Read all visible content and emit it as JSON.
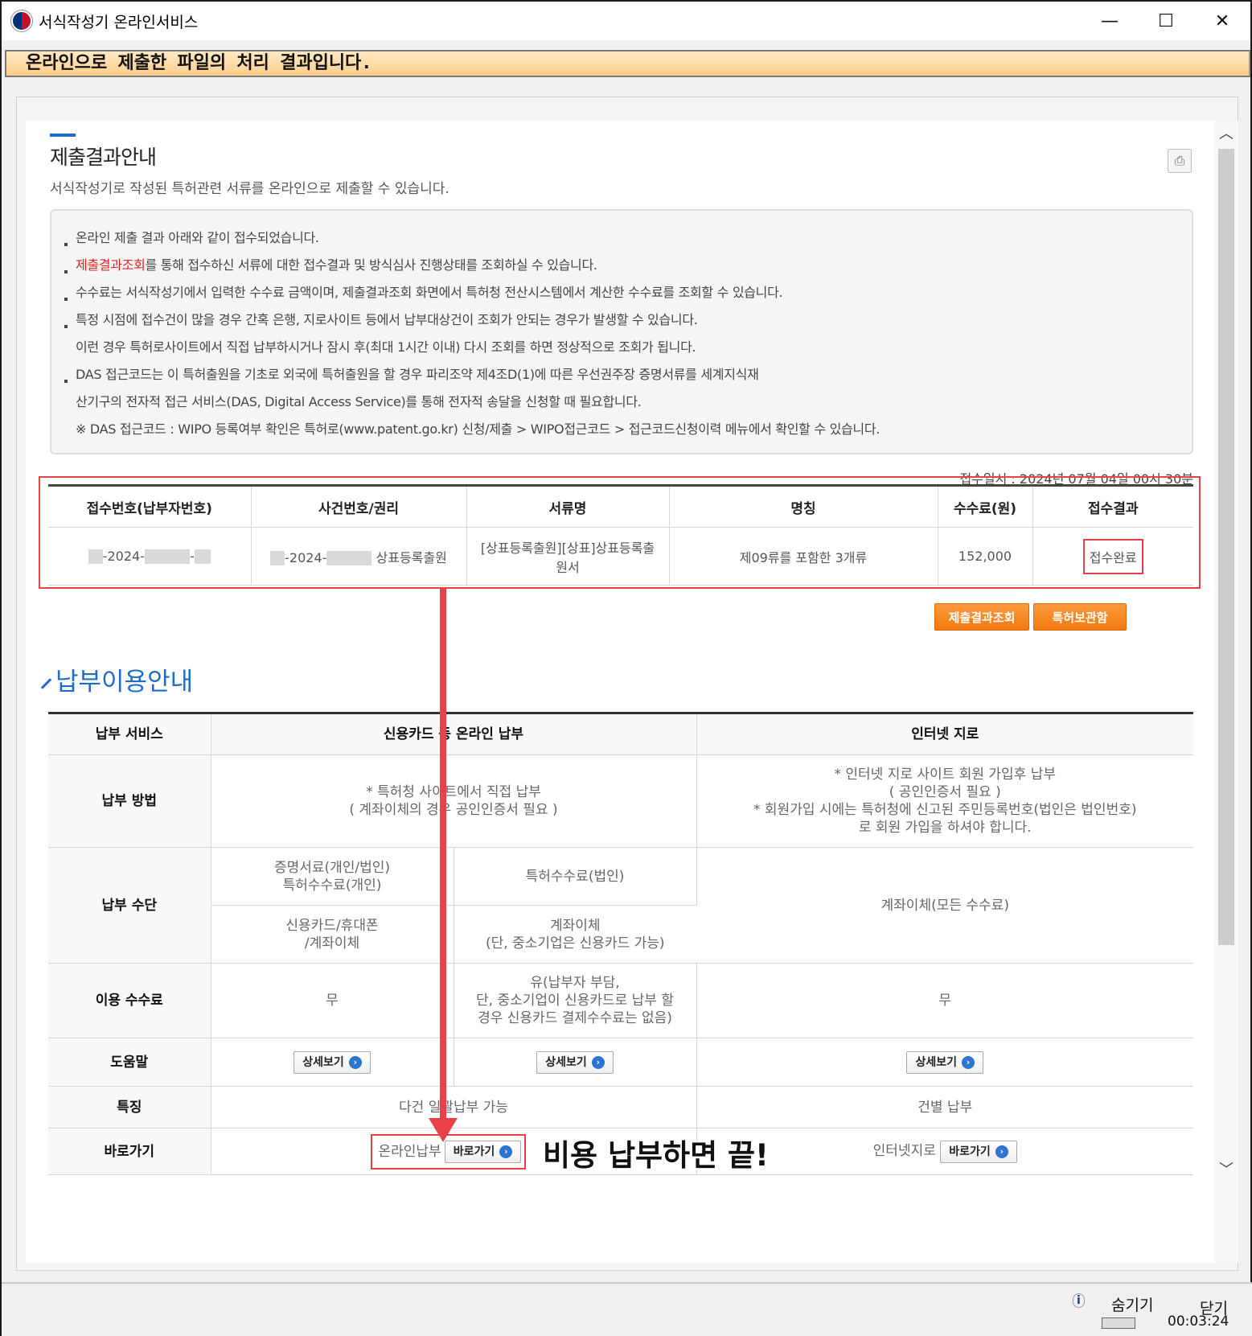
{
  "window": {
    "title": "서식작성기 온라인서비스",
    "minimize": "—",
    "maximize": "☐",
    "close": "✕"
  },
  "banner": "온라인으로 제출한 파일의 처리 결과입니다.",
  "section": {
    "title": "제출결과안내",
    "description": "서식작성기로 작성된 특허관련 서류를 온라인으로 제출할 수 있습니다."
  },
  "notice": {
    "line1": "온라인 제출 결과 아래와 같이 접수되었습니다.",
    "line2_red": "제출결과조회",
    "line2_rest": "를 통해 접수하신 서류에 대한 접수결과 및 방식심사 진행상태를 조회하실 수 있습니다.",
    "line3": "수수료는 서식작성기에서 입력한 수수료 금액이며, 제출결과조회 화면에서 특허청 전산시스템에서 계산한 수수료를 조회할 수 있습니다.",
    "line4": "특정 시점에 접수건이 많을 경우 간혹 은행, 지로사이트 등에서 납부대상건이 조회가 안되는 경우가 발생할 수 있습니다.",
    "line5": "이런 경우 특허로사이트에서 직접 납부하시거나 잠시 후(최대 1시간 이내) 다시 조회를 하면 정상적으로 조회가 됩니다.",
    "line6": "DAS 접근코드는 이 특허출원을 기초로 외국에 특허출원을 할 경우 파리조약 제4조D(1)에 따른 우선권주장 증명서류를 세계지식재",
    "line7": "산기구의 전자적 접근 서비스(DAS, Digital Access Service)를 통해 전자적 송달을 신청할 때 필요합니다.",
    "line8": "※ DAS 접근코드 : WIPO 등록여부 확인은 특허로(www.patent.go.kr) 신청/제출 > WIPO접근코드 > 접근코드신청이력 메뉴에서 확인할 수 있습니다."
  },
  "receipt_time": "접수일시 : 2024년 07월 04일 00시 30분",
  "result_table": {
    "headers": [
      "접수번호(납부자번호)",
      "사건번호/권리",
      "서류명",
      "명칭",
      "수수료(원)",
      "접수결과"
    ],
    "row": {
      "receipt_no_visible": "-2024-",
      "case_no_visible": "-2024-",
      "case_type": "상표등록출원",
      "doc_name": "[상표등록출원][상표]상표등록출원서",
      "name": "제09류를 포함한 3개류",
      "fee": "152,000",
      "result": "접수완료"
    }
  },
  "buttons": {
    "submit_result": "제출결과조회",
    "patent_storage": "특허보관함"
  },
  "pay_section_title": "납부이용안내",
  "pay_table": {
    "headers": [
      "납부 서비스",
      "신용카드 등 온라인 납부",
      "인터넷 지로"
    ],
    "method_label": "납부 방법",
    "method_online": "* 특허청 사이트에서 직접 납부\n( 계좌이체의 경우 공인인증서 필요 )",
    "method_giro": "* 인터넷 지로 사이트 회원 가입후 납부\n( 공인인증서 필요 )\n* 회원가입 시에는 특허청에 신고된 주민등록번호(법인은 법인번호)\n로 회원 가입을 하셔야 합니다.",
    "means_label": "납부 수단",
    "means_a1": "증명서료(개인/법인)\n특허수수료(개인)",
    "means_a2": "특허수수료(법인)",
    "means_b1": "신용카드/휴대폰\n/계좌이체",
    "means_b2": "계좌이체\n(단, 중소기업은 신용카드 가능)",
    "means_giro": "계좌이체(모든 수수료)",
    "fee_label": "이용 수수료",
    "fee_a": "무",
    "fee_b": "유(납부자 부담,\n단, 중소기업이 신용카드로 납부 할\n경우 신용카드 결제수수료는 없음)",
    "fee_giro": "무",
    "help_label": "도움말",
    "detail_btn": "상세보기",
    "feature_label": "특징",
    "feature_online": "다건 일괄납부 가능",
    "feature_giro": "건별 납부",
    "shortcut_label": "바로가기",
    "online_pay": "온라인납부",
    "giro_pay": "인터넷지로",
    "goto_btn": "바로가기"
  },
  "callout": "비용 납부하면 끝!",
  "status": {
    "hide": "숨기기",
    "close": "닫기",
    "timer": "00:03:24"
  },
  "colors": {
    "accent_blue": "#1f6bc7",
    "highlight_red": "#e8414a",
    "button_orange": "#f07a10"
  }
}
